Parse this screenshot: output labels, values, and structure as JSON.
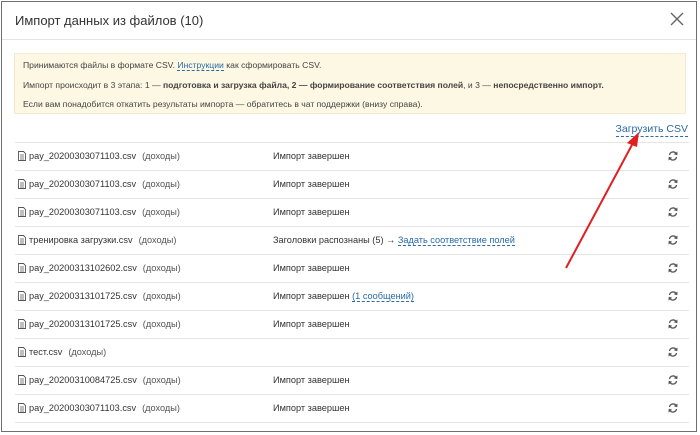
{
  "modal": {
    "title": "Импорт данных из файлов (10)",
    "info": {
      "line1_before": "Принимаются файлы в формате CSV. ",
      "line1_link": "Инструкции",
      "line1_after": " как сформировать CSV.",
      "line2_a": "Импорт происходит в 3 этапа: 1 — ",
      "line2_b": "подготовка и загрузка файла, 2 — формирование соответствия полей",
      "line2_c": ", и 3 — ",
      "line2_d": "непосредственно импорт.",
      "line3": "Если вам понадобится откатить результаты импорта — обратитесь в чат поддержки (внизу справа)."
    },
    "upload_label": "Загрузить CSV",
    "files": [
      {
        "name": "pay_20200303071103.csv",
        "kind": "(доходы)",
        "status": "Импорт завершен"
      },
      {
        "name": "pay_20200303071103.csv",
        "kind": "(доходы)",
        "status": "Импорт завершен"
      },
      {
        "name": "pay_20200303071103.csv",
        "kind": "(доходы)",
        "status": "Импорт завершен"
      },
      {
        "name": "тренировка загрузки.csv",
        "kind": "(доходы)",
        "status": "Заголовки распознаны (5) → ",
        "link": "Задать соответствие полей"
      },
      {
        "name": "pay_20200313102602.csv",
        "kind": "(доходы)",
        "status": "Импорт завершен"
      },
      {
        "name": "pay_20200313101725.csv",
        "kind": "(доходы)",
        "status": "Импорт завершен ",
        "link": "(1 сообщений)"
      },
      {
        "name": "pay_20200313101725.csv",
        "kind": "(доходы)",
        "status": "Импорт завершен"
      },
      {
        "name": "тест.csv",
        "kind": "(доходы)",
        "status": ""
      },
      {
        "name": "pay_20200310084725.csv",
        "kind": "(доходы)",
        "status": "Импорт завершен"
      },
      {
        "name": "pay_20200303071103.csv",
        "kind": "(доходы)",
        "status": "Импорт завершен"
      }
    ]
  },
  "colors": {
    "link": "#2a6aa8",
    "info_bg": "#fdf8e3",
    "arrow": "#e02020"
  }
}
